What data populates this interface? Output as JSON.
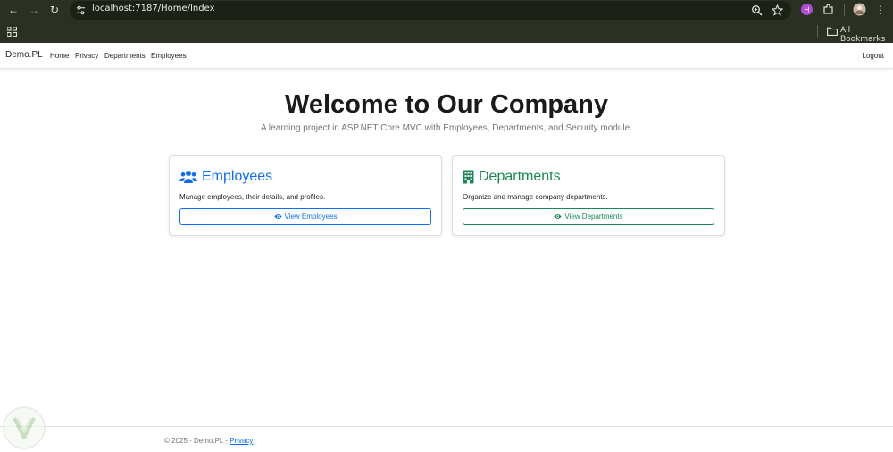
{
  "browser": {
    "url": "localhost:7187/Home/Index",
    "bookmarks_label": "All Bookmarks",
    "profile_badge": "H"
  },
  "navbar": {
    "brand": "Demo.PL",
    "links": [
      "Home",
      "Privacy",
      "Departments",
      "Employees"
    ],
    "logout": "Logout"
  },
  "hero": {
    "title": "Welcome to Our Company",
    "subtitle": "A learning project in ASP.NET Core MVC with Employees, Departments, and Security module."
  },
  "cards": [
    {
      "title": "Employees",
      "icon": "users-icon",
      "text": "Manage employees, their details, and profiles.",
      "button": "View Employees",
      "color": "#0d6efd"
    },
    {
      "title": "Departments",
      "icon": "building-icon",
      "text": "Organize and manage company departments.",
      "button": "View Departments",
      "color": "#198754"
    }
  ],
  "footer": {
    "copyright": "© 2025 - Demo.PL - ",
    "privacy": "Privacy"
  },
  "colors": {
    "chrome": "#2a3022",
    "primary": "#0d6efd",
    "success": "#198754"
  }
}
